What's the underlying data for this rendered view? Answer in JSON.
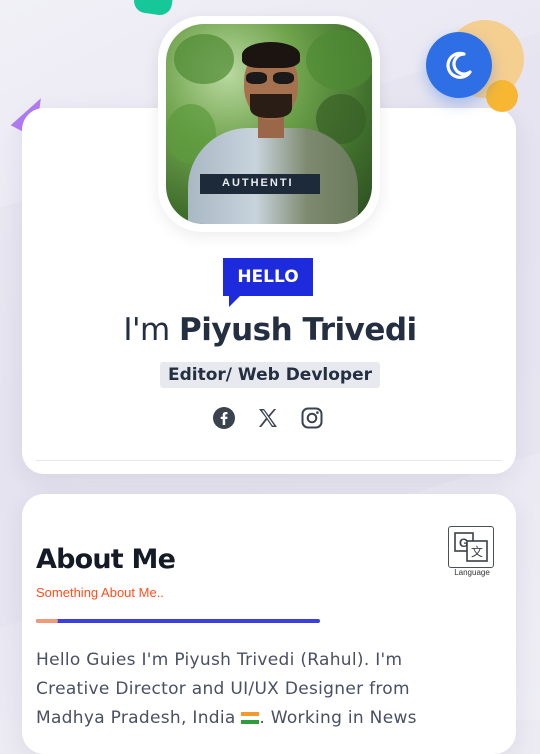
{
  "colors": {
    "accent_blue": "#1d2bdc",
    "progress_blue": "#3b3fe0",
    "subtitle_orange": "#ff4d1f",
    "theme_button": "#2f6fe6",
    "card_bg": "#ffffff",
    "page_bg": "#ecebf3"
  },
  "theme_toggle": {
    "icon": "moon-icon"
  },
  "profile": {
    "avatar_alt": "profile photo",
    "hello_tag": "HELLO",
    "name_prefix": "I'm",
    "name": "Piyush Trivedi",
    "role": "Editor/ Web Devloper",
    "socials": [
      {
        "icon": "facebook-icon"
      },
      {
        "icon": "x-twitter-icon"
      },
      {
        "icon": "instagram-icon"
      }
    ]
  },
  "about": {
    "title": "About Me",
    "subtitle": "Something About Me..",
    "language_label": "Language",
    "text_line1": "Hello Guies I'm Piyush Trivedi (Rahul). I'm",
    "text_line2": "Creative Director and UI/UX Designer from",
    "text_line3_start": "Madhya Pradesh, India",
    "text_line3_end": ". Working in News"
  },
  "shirt_text": "AUTHENTI"
}
